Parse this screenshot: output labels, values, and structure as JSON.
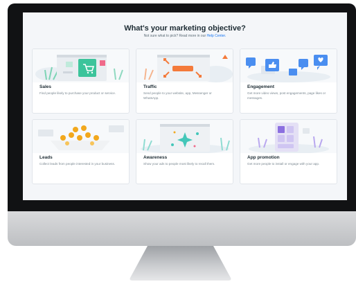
{
  "header": {
    "title": "What's your marketing objective?",
    "subtitle": "Not sure what to pick? Read more in our",
    "help_link": "Help Center."
  },
  "objectives": [
    {
      "title": "Sales",
      "description": "Find people likely to purchase your product or service.",
      "icon": "shopping-cart-icon"
    },
    {
      "title": "Traffic",
      "description": "Send people to your website, app, Messenger or WhatsApp.",
      "icon": "cursor-click-icon"
    },
    {
      "title": "Engagement",
      "description": "Get more video views, post engagements, page likes or messages.",
      "icon": "thumbs-up-icon"
    },
    {
      "title": "Leads",
      "description": "Collect leads from people interested in your business.",
      "icon": "coins-icon"
    },
    {
      "title": "Awareness",
      "description": "Show your ads to people most likely to recall them.",
      "icon": "sparkle-icon"
    },
    {
      "title": "App promotion",
      "description": "Get more people to install or engage with your app.",
      "icon": "mobile-app-icon"
    }
  ],
  "colors": {
    "accent": "#1877f2",
    "sales_green": "#3cc49b",
    "traffic_orange": "#f47a3a",
    "engagement_blue": "#4a8ef0",
    "leads_gold": "#f2a81d",
    "awareness_teal": "#44c7b9",
    "app_purple": "#8b6fe0"
  }
}
